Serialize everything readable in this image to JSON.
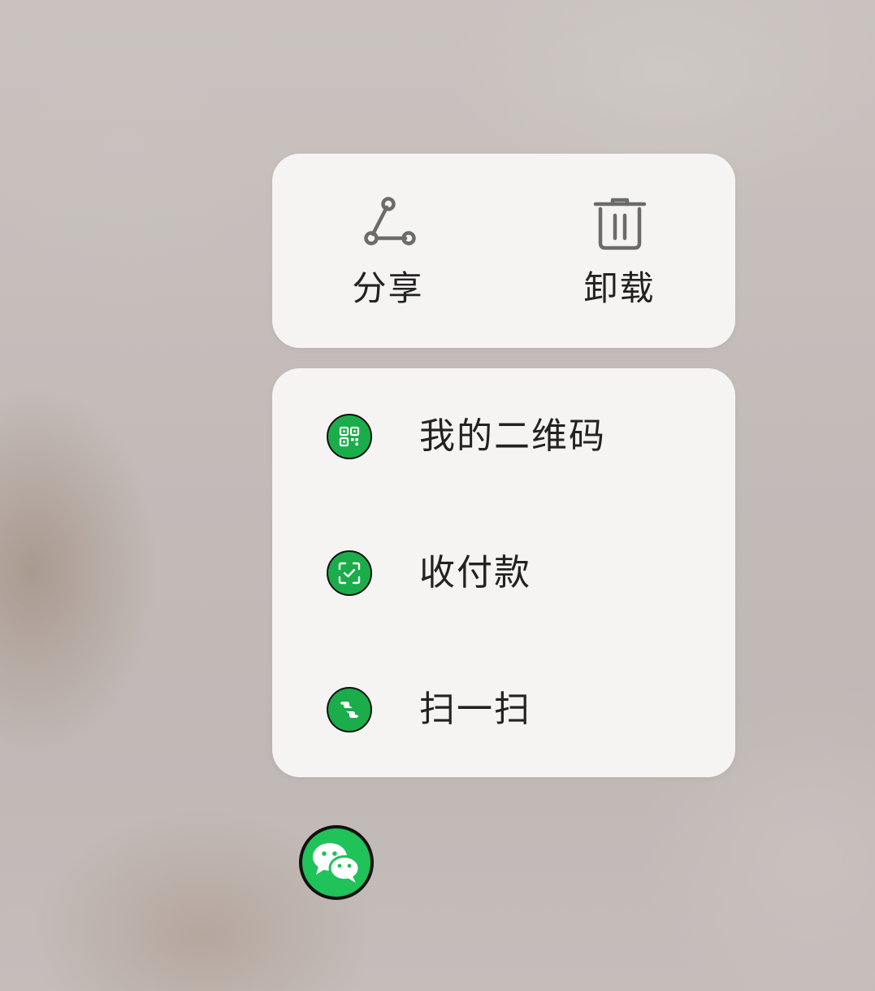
{
  "quick_actions": {
    "share_label": "分享",
    "share_icon": "share-icon",
    "uninstall_label": "卸载",
    "uninstall_icon": "trash-icon"
  },
  "shortcuts": [
    {
      "label": "我的二维码",
      "icon": "qr-code-icon"
    },
    {
      "label": "收付款",
      "icon": "payment-scan-icon"
    },
    {
      "label": "扫一扫",
      "icon": "scan-icon"
    }
  ],
  "app": {
    "icon": "wechat-icon"
  },
  "colors": {
    "card_background": "#f5f4f3",
    "brand_green": "#1aad4a",
    "text": "#222222",
    "icon_gray": "#6b6b6b"
  }
}
